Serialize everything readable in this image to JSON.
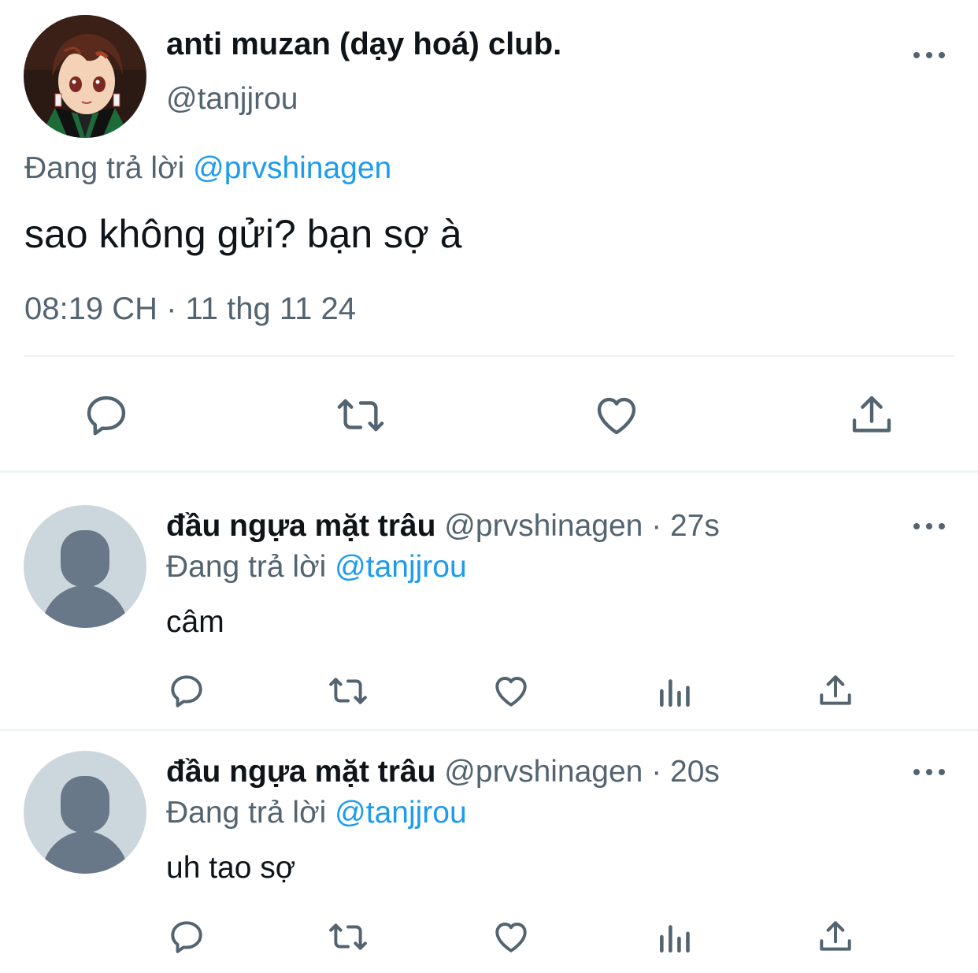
{
  "main_tweet": {
    "display_name": "anti muzan (dạy hoá) club.",
    "handle": "@tanjjrou",
    "replying_label": "Đang trả lời",
    "replying_to": "@prvshinagen",
    "text": "sao không gửi? bạn sợ à",
    "timestamp": "08:19 CH · 11 thg 11 24",
    "actions": [
      "reply-icon",
      "retweet-icon",
      "like-icon",
      "share-icon"
    ]
  },
  "replies": [
    {
      "display_name": "đầu ngựa mặt trâu",
      "handle": "@prvshinagen",
      "time": "· 27s",
      "replying_label": "Đang trả lời",
      "replying_to": "@tanjjrou",
      "text": "câm"
    },
    {
      "display_name": "đầu ngựa mặt trâu",
      "handle": "@prvshinagen",
      "time": "· 20s",
      "replying_label": "Đang trả lời",
      "replying_to": "@tanjjrou",
      "text": "uh tao sợ"
    }
  ],
  "reply_actions": [
    "reply-icon",
    "retweet-icon",
    "like-icon",
    "views-icon",
    "share-icon"
  ],
  "colors": {
    "text": "#0f1419",
    "secondary": "#536471",
    "link": "#1d9bf0",
    "divider": "#eff3f4",
    "default_avatar": "#ccd6dd"
  }
}
